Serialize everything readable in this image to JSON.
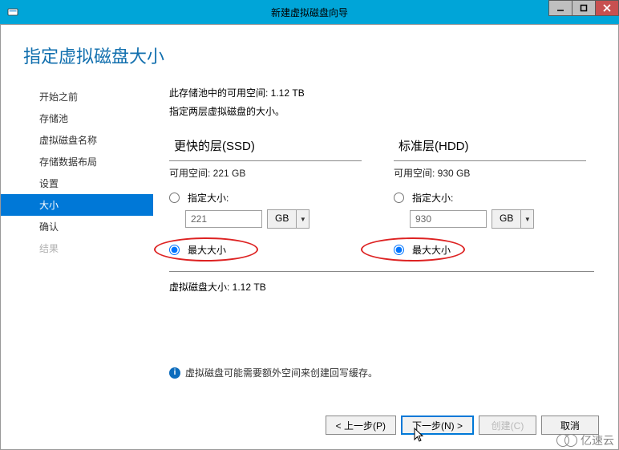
{
  "titlebar": {
    "title": "新建虚拟磁盘向导"
  },
  "page_title": "指定虚拟磁盘大小",
  "sidebar": {
    "items": [
      {
        "label": "开始之前",
        "state": "normal"
      },
      {
        "label": "存储池",
        "state": "normal"
      },
      {
        "label": "虚拟磁盘名称",
        "state": "normal"
      },
      {
        "label": "存储数据布局",
        "state": "normal"
      },
      {
        "label": "设置",
        "state": "normal"
      },
      {
        "label": "大小",
        "state": "active"
      },
      {
        "label": "确认",
        "state": "normal"
      },
      {
        "label": "结果",
        "state": "disabled"
      }
    ]
  },
  "content": {
    "pool_line": "此存储池中的可用空间: 1.12 TB",
    "instruction": "指定两层虚拟磁盘的大小。",
    "tiers": [
      {
        "heading": "更快的层(SSD)",
        "free_space": "可用空间: 221 GB",
        "specify_label": "指定大小:",
        "specify_value": "221",
        "unit": "GB",
        "max_label": "最大大小",
        "selected": "max"
      },
      {
        "heading": "标准层(HDD)",
        "free_space": "可用空间: 930 GB",
        "specify_label": "指定大小:",
        "specify_value": "930",
        "unit": "GB",
        "max_label": "最大大小",
        "selected": "max"
      }
    ],
    "total_line": "虚拟磁盘大小: 1.12 TB",
    "hint": "虚拟磁盘可能需要额外空间来创建回写缓存。"
  },
  "footer": {
    "prev": "< 上一步(P)",
    "next": "下一步(N) >",
    "create": "创建(C)",
    "cancel": "取消"
  },
  "watermark": "亿速云"
}
